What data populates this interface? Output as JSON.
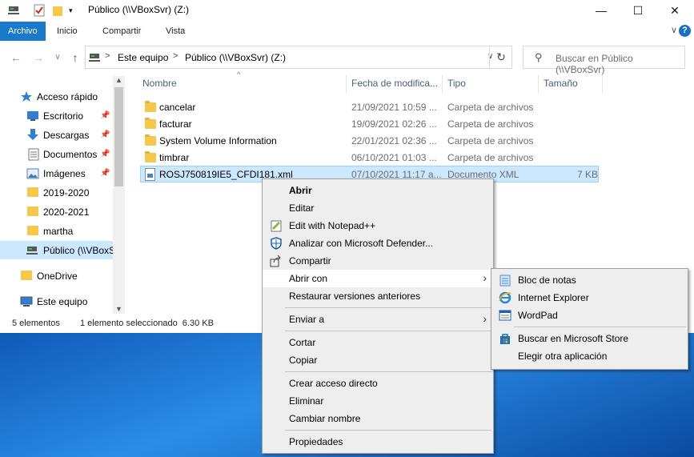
{
  "window": {
    "title": "Público (\\\\VBoxSvr) (Z:)",
    "minimize_glyph": "—",
    "maximize_glyph": "☐",
    "close_glyph": "✕"
  },
  "ribbon": {
    "tabs": [
      "Archivo",
      "Inicio",
      "Compartir",
      "Vista"
    ],
    "expand_glyph": "∨",
    "help_glyph": "?"
  },
  "address": {
    "segments": [
      "Este equipo",
      "Público (\\\\VBoxSvr) (Z:)"
    ],
    "separator": ">",
    "search_placeholder": "Buscar en Público (\\\\VBoxSvr)"
  },
  "nav_pane": {
    "items": [
      {
        "label": "Acceso rápido",
        "icon": "star-icon",
        "pinned": false
      },
      {
        "label": "Escritorio",
        "icon": "desktop-icon",
        "pinned": true
      },
      {
        "label": "Descargas",
        "icon": "download-arrow-icon",
        "pinned": true
      },
      {
        "label": "Documentos",
        "icon": "document-icon",
        "pinned": true
      },
      {
        "label": "Imágenes",
        "icon": "images-icon",
        "pinned": true
      },
      {
        "label": "2019-2020",
        "icon": "folder-icon",
        "pinned": false
      },
      {
        "label": "2020-2021",
        "icon": "folder-icon",
        "pinned": false
      },
      {
        "label": "martha",
        "icon": "folder-icon",
        "pinned": false
      },
      {
        "label": "Público (\\\\VBoxSvr)",
        "icon": "network-drive-icon",
        "pinned": false
      },
      {
        "label": "OneDrive",
        "icon": "folder-icon",
        "pinned": false
      },
      {
        "label": "Este equipo",
        "icon": "computer-icon",
        "pinned": false
      }
    ]
  },
  "columns": [
    "Nombre",
    "Fecha de modifica...",
    "Tipo",
    "Tamaño"
  ],
  "files": [
    {
      "name": "cancelar",
      "date": "21/09/2021 10:59 ...",
      "type": "Carpeta de archivos",
      "size": "",
      "icon": "folder-icon"
    },
    {
      "name": "facturar",
      "date": "19/09/2021 02:26 ...",
      "type": "Carpeta de archivos",
      "size": "",
      "icon": "folder-icon"
    },
    {
      "name": "System Volume Information",
      "date": "22/01/2021 02:36 ...",
      "type": "Carpeta de archivos",
      "size": "",
      "icon": "folder-icon"
    },
    {
      "name": "timbrar",
      "date": "06/10/2021 01:03 ...",
      "type": "Carpeta de archivos",
      "size": "",
      "icon": "folder-icon"
    },
    {
      "name": "ROSJ750819IE5_CFDI181.xml",
      "date": "07/10/2021 11:17 a...",
      "type": "Documento XML",
      "size": "7 KB",
      "icon": "xml-file-icon"
    }
  ],
  "status": {
    "count": "5 elementos",
    "selection": "1 elemento seleccionado  6.30 KB"
  },
  "context_menu": {
    "items": [
      {
        "label": "Abrir",
        "bold": true
      },
      {
        "label": "Editar"
      },
      {
        "label": "Edit with Notepad++",
        "icon": "notepadpp-icon"
      },
      {
        "label": "Analizar con Microsoft Defender...",
        "icon": "defender-shield-icon"
      },
      {
        "label": "Compartir",
        "icon": "share-icon"
      },
      {
        "label": "Abrir con",
        "submenu": true,
        "highlighted": true
      },
      {
        "label": "Restaurar versiones anteriores"
      },
      {
        "label": "Enviar a",
        "submenu": true
      },
      {
        "label": "Cortar"
      },
      {
        "label": "Copiar"
      },
      {
        "label": "Crear acceso directo"
      },
      {
        "label": "Eliminar"
      },
      {
        "label": "Cambiar nombre"
      },
      {
        "label": "Propiedades"
      }
    ],
    "submenu_arrow": "›"
  },
  "open_with_menu": {
    "items": [
      {
        "label": "Bloc de notas",
        "icon": "notepad-icon"
      },
      {
        "label": "Internet Explorer",
        "icon": "internet-explorer-icon"
      },
      {
        "label": "WordPad",
        "icon": "wordpad-icon"
      },
      {
        "label": "Buscar en Microsoft Store",
        "icon": "store-bag-icon"
      },
      {
        "label": "Elegir otra aplicación"
      }
    ]
  },
  "colors": {
    "accent": "#1979ca",
    "selection": "#cce8ff",
    "folder": "#f5c84c"
  }
}
